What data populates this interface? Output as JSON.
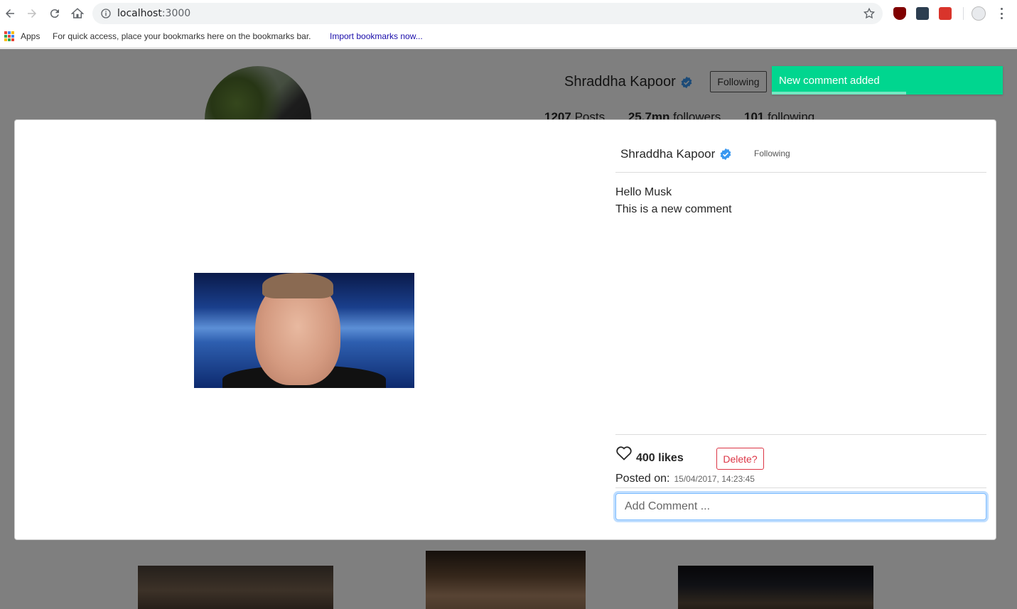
{
  "browser": {
    "url_host": "localhost",
    "url_port": ":3000",
    "bookmarks": {
      "apps_label": "Apps",
      "hint": "For quick access, place your bookmarks here on the bookmarks bar.",
      "import_link": "Import bookmarks now..."
    }
  },
  "profile": {
    "name": "Shraddha Kapoor",
    "follow_label": "Following",
    "stats": {
      "posts": "1207",
      "posts_label": "Posts",
      "followers": "25.7mn",
      "followers_label": "followers",
      "following": "101",
      "following_label": "following"
    }
  },
  "toast": {
    "message": "New comment added",
    "color": "#00d68f",
    "progress": 0.58
  },
  "modal": {
    "author": "Shraddha Kapoor",
    "follow_label": "Following",
    "caption_lines": [
      "Hello Musk",
      "This is a new comment"
    ],
    "likes": "400 likes",
    "delete_label": "Delete?",
    "posted_label": "Posted on:",
    "posted_date": "15/04/2017, 14:23:45",
    "comment_placeholder": "Add Comment ..."
  },
  "colors": {
    "verified": "#3897f0",
    "delete": "#dc3545",
    "focus": "#80bdff"
  },
  "icons": [
    "back-arrow-icon",
    "forward-arrow-icon",
    "reload-icon",
    "home-icon",
    "info-icon",
    "bookmark-star-icon",
    "verified-badge-icon",
    "heart-icon"
  ]
}
